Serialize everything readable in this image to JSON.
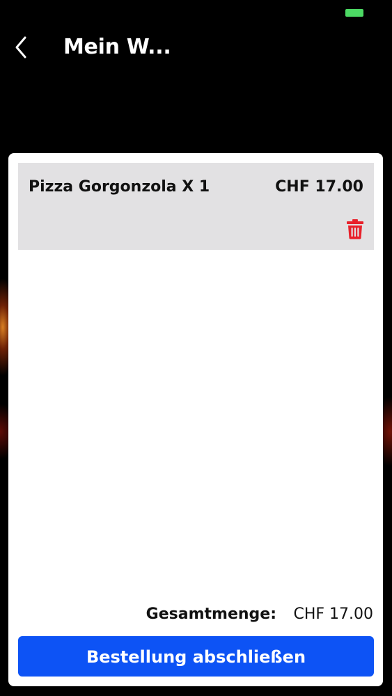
{
  "status_bar": {
    "battery_color": "#4cd964"
  },
  "header": {
    "back_icon": "chevron-left-icon",
    "title": "Mein W..."
  },
  "cart": {
    "items": [
      {
        "name": "Pizza Gorgonzola X 1",
        "price": "CHF 17.00",
        "delete_icon": "trash-icon",
        "delete_icon_color": "#e8202a"
      }
    ],
    "total_label": "Gesamtmenge:",
    "total_value": "CHF 17.00"
  },
  "checkout": {
    "label": "Bestellung abschließen",
    "color": "#0d53f5"
  }
}
